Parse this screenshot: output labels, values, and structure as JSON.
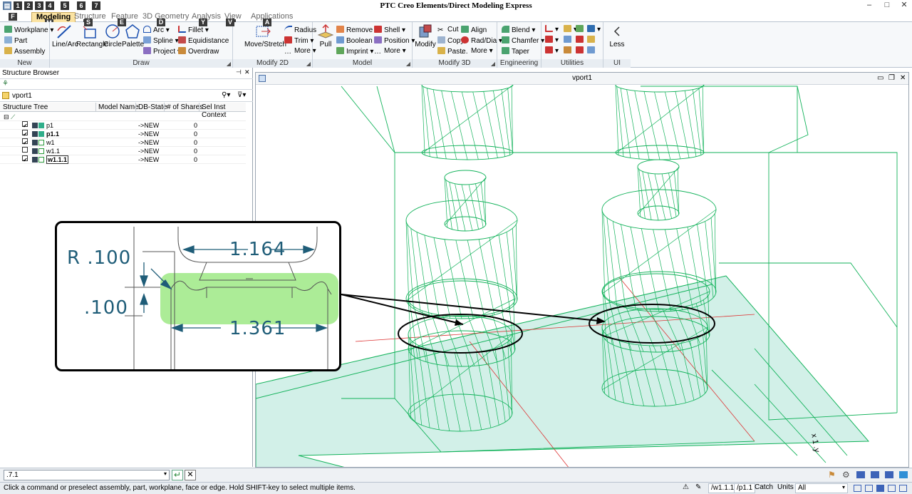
{
  "app": {
    "title": "PTC Creo Elements/Direct Modeling Express",
    "qat_keytips": [
      "1",
      "2",
      "3",
      "4",
      "5",
      "6",
      "7"
    ],
    "file_keytip": "F"
  },
  "tabs": [
    {
      "label": "Modeling",
      "keytip": "M",
      "active": true
    },
    {
      "label": "Structure",
      "keytip": "S"
    },
    {
      "label": "Feature",
      "keytip": "E"
    },
    {
      "label": "3D Geometry",
      "keytip": "D"
    },
    {
      "label": "Analysis",
      "keytip": "Y"
    },
    {
      "label": "View",
      "keytip": "V"
    },
    {
      "label": "Applications",
      "keytip": "A"
    }
  ],
  "ribbon": {
    "new": {
      "label": "New",
      "items": [
        "Workplane",
        "Part",
        "Assembly"
      ]
    },
    "draw": {
      "label": "Draw",
      "line_arc": "Line/Arc",
      "rectangle": "Rectangle",
      "circle": "Circle",
      "palette": "Palette",
      "arc": "Arc",
      "spline": "Spline",
      "project": "Project",
      "fillet": "Fillet",
      "equidistance": "Equidistance",
      "overdraw": "Overdraw"
    },
    "modify2d": {
      "label": "Modify 2D",
      "move_stretch": "Move/Stretch",
      "radius": "Radius",
      "trim": "Trim",
      "more": "More"
    },
    "model": {
      "label": "Model",
      "pull": "Pull",
      "remove": "Remove",
      "boolean": "Boolean",
      "imprint": "Imprint",
      "shell": "Shell",
      "position": "Position",
      "more": "More"
    },
    "modify3d": {
      "label": "Modify 3D",
      "modify": "Modify",
      "cut": "Cut",
      "copy": "Copy",
      "paste": "Paste",
      "align": "Align",
      "rad_dia": "Rad/Dia",
      "more": "More"
    },
    "engineering": {
      "label": "Engineering",
      "blend": "Blend",
      "chamfer": "Chamfer",
      "taper": "Taper"
    },
    "utilities": {
      "label": "Utilities"
    },
    "ui": {
      "label": "UI",
      "less": "Less"
    }
  },
  "structure_browser": {
    "title": "Structure Browser",
    "vport": "vport1",
    "columns": [
      "Structure Tree",
      "Model Name",
      "DB-State",
      "# of Shares",
      "Sel Inst Context"
    ],
    "rows": [
      {
        "name": "p1",
        "bold": false,
        "checked": true,
        "state": "->NEW",
        "shares": "0"
      },
      {
        "name": "p1.1",
        "bold": true,
        "checked": true,
        "state": "->NEW",
        "shares": "0"
      },
      {
        "name": "w1",
        "bold": false,
        "checked": true,
        "state": "->NEW",
        "shares": "0"
      },
      {
        "name": "w1.1",
        "bold": false,
        "checked": false,
        "state": "->NEW",
        "shares": "0"
      },
      {
        "name": "w1.1.1",
        "bold": true,
        "checked": true,
        "state": "->NEW",
        "shares": "0"
      }
    ]
  },
  "viewport": {
    "title": "vport1"
  },
  "callout": {
    "radius_label": "R .100",
    "height_label": ".100",
    "top_width_label": "1.164",
    "bottom_width_label": "1.361"
  },
  "command": {
    "value": ".7.1"
  },
  "status": {
    "message": "Click a command or preselect assembly, part, workplane, face or edge. Hold SHIFT-key to select multiple items.",
    "workplane": "/w1.1.1",
    "part": "/p1.1",
    "catch": "Catch",
    "units": "Units",
    "filter": "All"
  },
  "colors": {
    "wire": "#12b25a",
    "plate": "#bfe9de",
    "accent": "#fbe3a2",
    "highlight": "#9ee985"
  }
}
